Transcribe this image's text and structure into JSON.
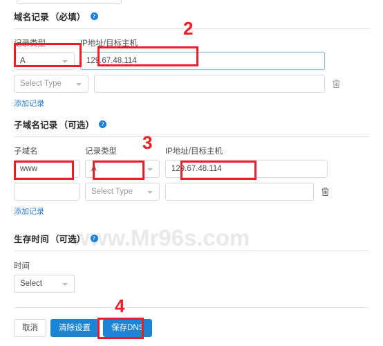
{
  "top_select": {
    "caret_icon": "chevron-down-icon"
  },
  "sections": {
    "domain_records": {
      "title": "域名记录",
      "qualifier": "（必填）",
      "help_icon": "help-circle-icon",
      "columns": {
        "record_type": "记录类型",
        "ip_host": "IP地址/目标主机"
      },
      "rows": [
        {
          "record_type": "A",
          "ip_host": "129.67.48.114"
        },
        {
          "record_type": "Select Type",
          "ip_host": ""
        }
      ],
      "add_link": "添加记录",
      "delete_icon": "trash-icon"
    },
    "subdomain_records": {
      "title": "子域名记录",
      "qualifier": "（可选）",
      "help_icon": "help-circle-icon",
      "columns": {
        "subdomain": "子域名",
        "record_type": "记录类型",
        "ip_host": "IP地址/目标主机"
      },
      "rows": [
        {
          "subdomain": "www",
          "record_type": "A",
          "ip_host": "129.67.48.114"
        },
        {
          "subdomain": "",
          "record_type": "Select Type",
          "ip_host": ""
        }
      ],
      "add_link": "添加记录",
      "delete_icon": "trash-icon"
    },
    "ttl": {
      "title": "生存时间",
      "qualifier": "（可选）",
      "help_icon": "help-circle-icon",
      "columns": {
        "time": "时间"
      },
      "value": "Select"
    }
  },
  "footer": {
    "cancel": "取消",
    "clear": "清除设置",
    "save": "保存DNS"
  },
  "annotations": {
    "step2": "2",
    "step3": "3",
    "step4": "4",
    "highlight_color": "#ee1c25"
  },
  "watermark": {
    "text": "www.Mr96s.com"
  }
}
